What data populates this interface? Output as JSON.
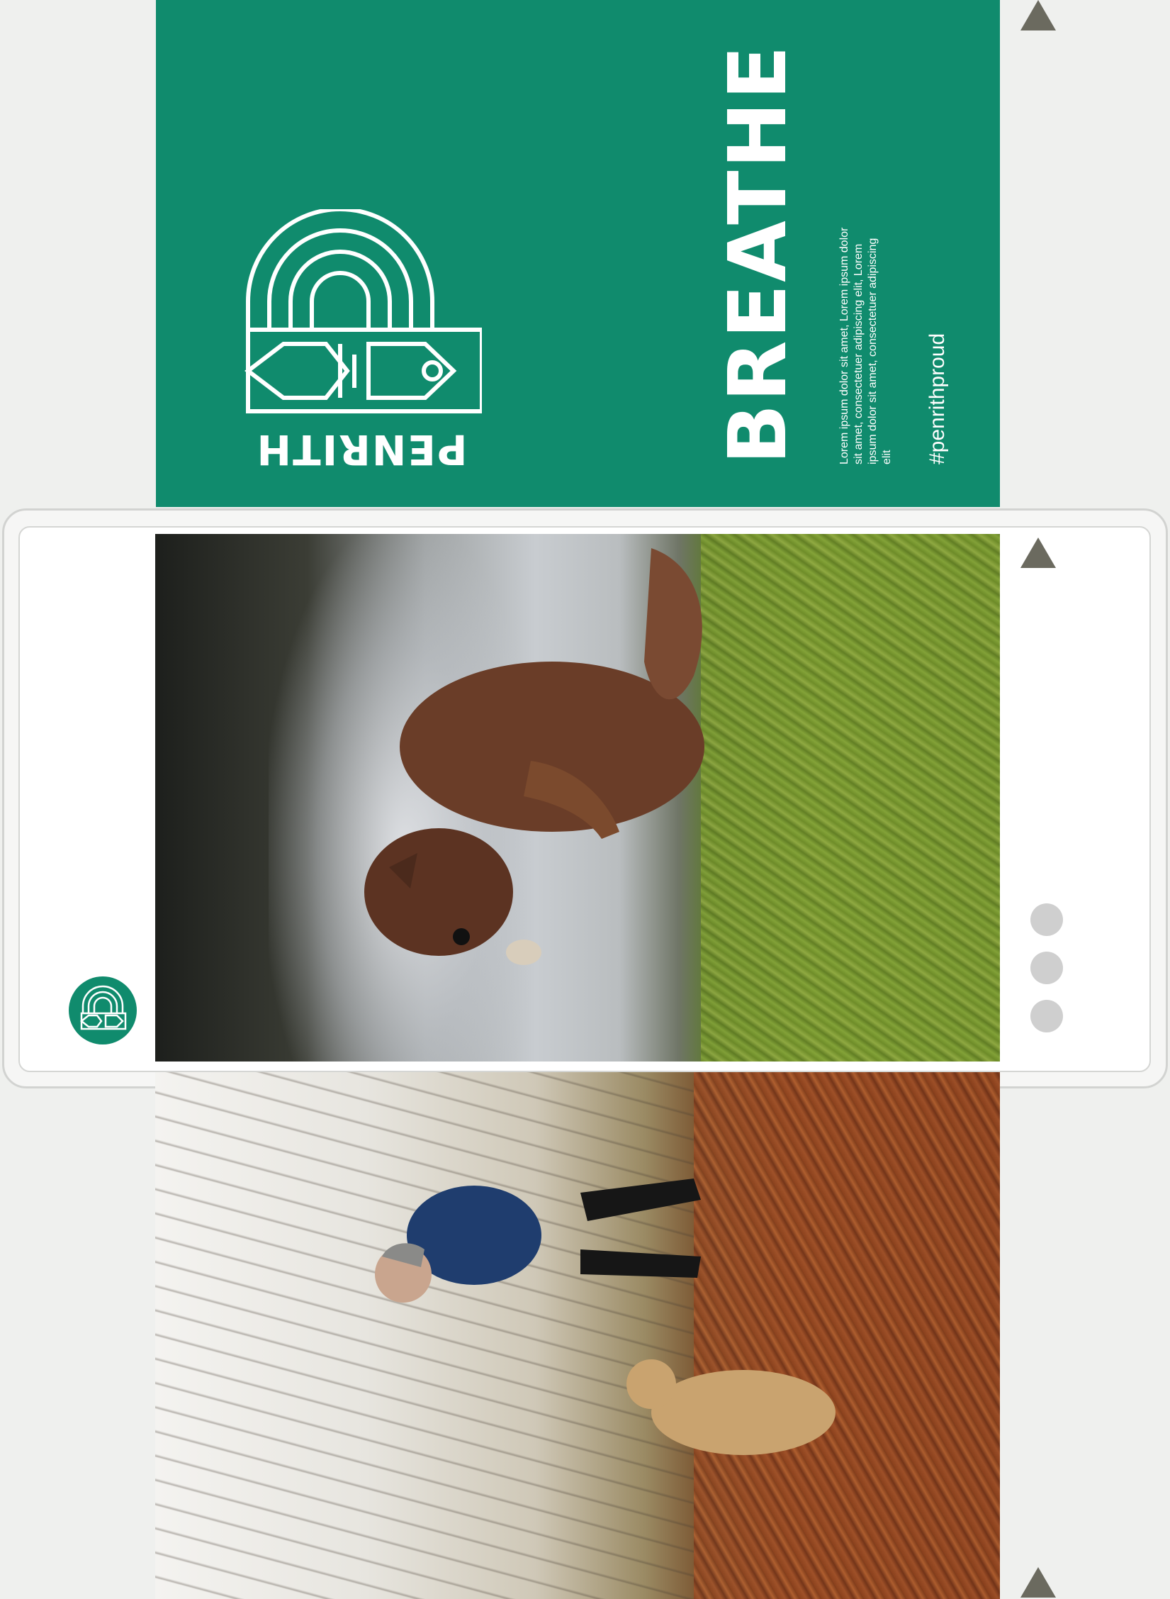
{
  "poster": {
    "headline": "BREATHE",
    "body_copy": "Lorem ipsum dolor sit amet, Lorem ipsum dolor sit amet, consectetuer adipiscing elit, Lorem ipsum dolor sit amet, consectetuer adipiscing elit",
    "hashtag": "#penrithproud",
    "logo_wordmark": "PENRITH",
    "background_color": "#108b6d"
  },
  "phone": {
    "photo": "squirrel-photo",
    "page_indicator_dots": 3,
    "badge_icon": "penrith-logo-icon"
  },
  "bottom_photo": "woodland-walk-photo",
  "nav_icons": [
    "triangle-up-icon",
    "triangle-up-icon",
    "triangle-up-icon"
  ]
}
